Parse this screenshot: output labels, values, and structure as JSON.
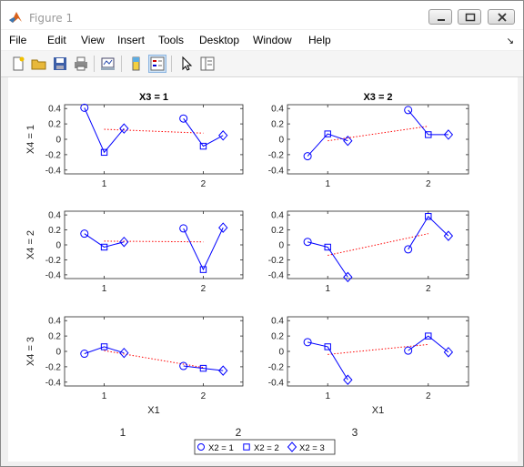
{
  "window": {
    "title": "Figure 1"
  },
  "menu": [
    "File",
    "Edit",
    "View",
    "Insert",
    "Tools",
    "Desktop",
    "Window",
    "Help"
  ],
  "toolbar": [
    "new-figure",
    "open-file",
    "save",
    "print",
    "link-data",
    "insert-colorbar",
    "insert-legend",
    "edit-plot",
    "property-inspector"
  ],
  "colors": {
    "series": "#0000ff",
    "reference": "#ff0000",
    "axes": "#262626"
  },
  "figure": {
    "bottom_labels": [
      "1",
      "2",
      "3"
    ],
    "legend": [
      "X2 = 1",
      "X2 = 2",
      "X2 = 3"
    ]
  },
  "chart_data": [
    {
      "type": "line",
      "title": "X3 = 1",
      "xlabel": "",
      "ylabel": "X4 = 1",
      "xticks": [
        "1",
        "2"
      ],
      "ylim": [
        -0.45,
        0.45
      ],
      "yticks": [
        "0.4",
        "0.2",
        "0",
        "-0.2",
        "-0.4"
      ],
      "groups": [
        {
          "x": [
            0.8,
            1.0,
            1.2
          ],
          "y": [
            0.41,
            -0.17,
            0.14
          ]
        },
        {
          "x": [
            1.8,
            2.0,
            2.2
          ],
          "y": [
            0.27,
            -0.09,
            0.05
          ]
        }
      ],
      "reference": {
        "x": [
          1.0,
          2.0
        ],
        "y": [
          0.13,
          0.08
        ]
      }
    },
    {
      "type": "line",
      "title": "X3 = 2",
      "xlabel": "",
      "ylabel": "",
      "xticks": [
        "1",
        "2"
      ],
      "ylim": [
        -0.45,
        0.45
      ],
      "yticks": [
        "0.4",
        "0.2",
        "0",
        "-0.2",
        "-0.4"
      ],
      "groups": [
        {
          "x": [
            0.8,
            1.0,
            1.2
          ],
          "y": [
            -0.22,
            0.07,
            -0.02
          ]
        },
        {
          "x": [
            1.8,
            2.0,
            2.2
          ],
          "y": [
            0.38,
            0.06,
            0.06
          ]
        }
      ],
      "reference": {
        "x": [
          1.0,
          2.0
        ],
        "y": [
          -0.02,
          0.17
        ]
      }
    },
    {
      "type": "line",
      "title": "",
      "xlabel": "",
      "ylabel": "X4 = 2",
      "xticks": [
        "1",
        "2"
      ],
      "ylim": [
        -0.45,
        0.45
      ],
      "yticks": [
        "0.4",
        "0.2",
        "0",
        "-0.2",
        "-0.4"
      ],
      "groups": [
        {
          "x": [
            0.8,
            1.0,
            1.2
          ],
          "y": [
            0.15,
            -0.03,
            0.04
          ]
        },
        {
          "x": [
            1.8,
            2.0,
            2.2
          ],
          "y": [
            0.22,
            -0.33,
            0.23
          ]
        }
      ],
      "reference": {
        "x": [
          1.0,
          2.0
        ],
        "y": [
          0.05,
          0.04
        ]
      }
    },
    {
      "type": "line",
      "title": "",
      "xlabel": "",
      "ylabel": "",
      "xticks": [
        "1",
        "2"
      ],
      "ylim": [
        -0.45,
        0.45
      ],
      "yticks": [
        "0.4",
        "0.2",
        "0",
        "-0.2",
        "-0.4"
      ],
      "groups": [
        {
          "x": [
            0.8,
            1.0,
            1.2
          ],
          "y": [
            0.04,
            -0.03,
            -0.43
          ]
        },
        {
          "x": [
            1.8,
            2.0,
            2.2
          ],
          "y": [
            -0.06,
            0.38,
            0.12
          ]
        }
      ],
      "reference": {
        "x": [
          1.0,
          2.0
        ],
        "y": [
          -0.14,
          0.15
        ]
      }
    },
    {
      "type": "line",
      "title": "",
      "xlabel": "X1",
      "ylabel": "X4 = 3",
      "xticks": [
        "1",
        "2"
      ],
      "ylim": [
        -0.45,
        0.45
      ],
      "yticks": [
        "0.4",
        "0.2",
        "0",
        "-0.2",
        "-0.4"
      ],
      "groups": [
        {
          "x": [
            0.8,
            1.0,
            1.2
          ],
          "y": [
            -0.03,
            0.06,
            -0.02
          ]
        },
        {
          "x": [
            1.8,
            2.0,
            2.2
          ],
          "y": [
            -0.19,
            -0.22,
            -0.25
          ]
        }
      ],
      "reference": {
        "x": [
          1.0,
          2.0
        ],
        "y": [
          0.01,
          -0.21
        ]
      }
    },
    {
      "type": "line",
      "title": "",
      "xlabel": "X1",
      "ylabel": "",
      "xticks": [
        "1",
        "2"
      ],
      "ylim": [
        -0.45,
        0.45
      ],
      "yticks": [
        "0.4",
        "0.2",
        "0",
        "-0.2",
        "-0.4"
      ],
      "groups": [
        {
          "x": [
            0.8,
            1.0,
            1.2
          ],
          "y": [
            0.12,
            0.06,
            -0.37
          ]
        },
        {
          "x": [
            1.8,
            2.0,
            2.2
          ],
          "y": [
            0.01,
            0.2,
            -0.01
          ]
        }
      ],
      "reference": {
        "x": [
          1.0,
          2.0
        ],
        "y": [
          -0.04,
          0.09
        ]
      }
    }
  ]
}
